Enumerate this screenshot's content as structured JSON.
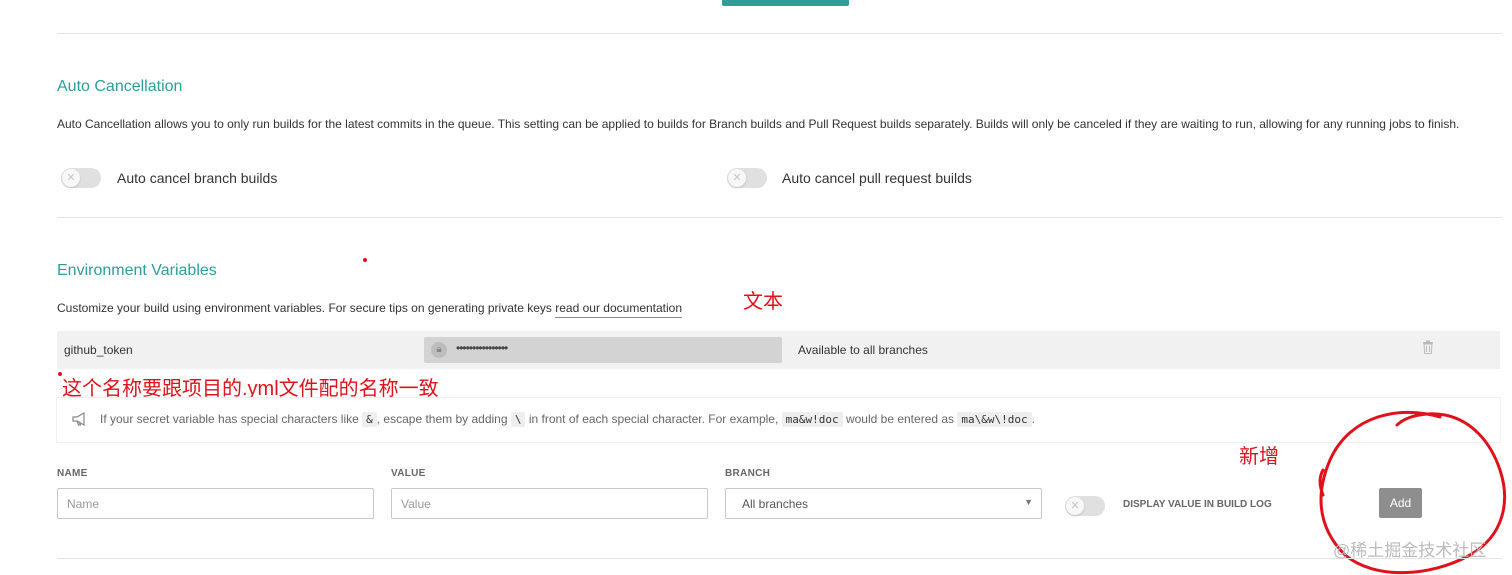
{
  "auto_cancellation": {
    "title": "Auto Cancellation",
    "description": "Auto Cancellation allows you to only run builds for the latest commits in the queue. This setting can be applied to builds for Branch builds and Pull Request builds separately. Builds will only be canceled if they are waiting to run, allowing for any running jobs to finish.",
    "branch_label": "Auto cancel branch builds",
    "branch_enabled": false,
    "pr_label": "Auto cancel pull request builds",
    "pr_enabled": false
  },
  "env_vars": {
    "title": "Environment Variables",
    "description_prefix": "Customize your build using environment variables. For secure tips on generating private keys",
    "doc_link": "read our documentation",
    "variables": [
      {
        "name": "github_token",
        "value": "••••••••••••••••",
        "branch": "Available to all branches"
      }
    ],
    "notice": {
      "t1": "If your secret variable has special characters like",
      "c1": "&",
      "t2": ", escape them by adding",
      "c2": "\\",
      "t3": "in front of each special character. For example,",
      "c3": "ma&w!doc",
      "t4": "would be entered as",
      "c4": "ma\\&w\\!doc",
      "t5": "."
    },
    "form": {
      "name_label": "NAME",
      "name_placeholder": "Name",
      "value_label": "VALUE",
      "value_placeholder": "Value",
      "branch_label": "BRANCH",
      "branch_selected": "All branches",
      "display_label": "DISPLAY VALUE IN BUILD LOG",
      "display_enabled": false,
      "add_label": "Add"
    }
  },
  "annotations": {
    "text_note": "文本",
    "name_note": "这个名称要跟项目的.yml文件配的名称一致",
    "add_note": "新增",
    "color": "#e0111b"
  },
  "watermark": "@稀土掘金技术社区"
}
